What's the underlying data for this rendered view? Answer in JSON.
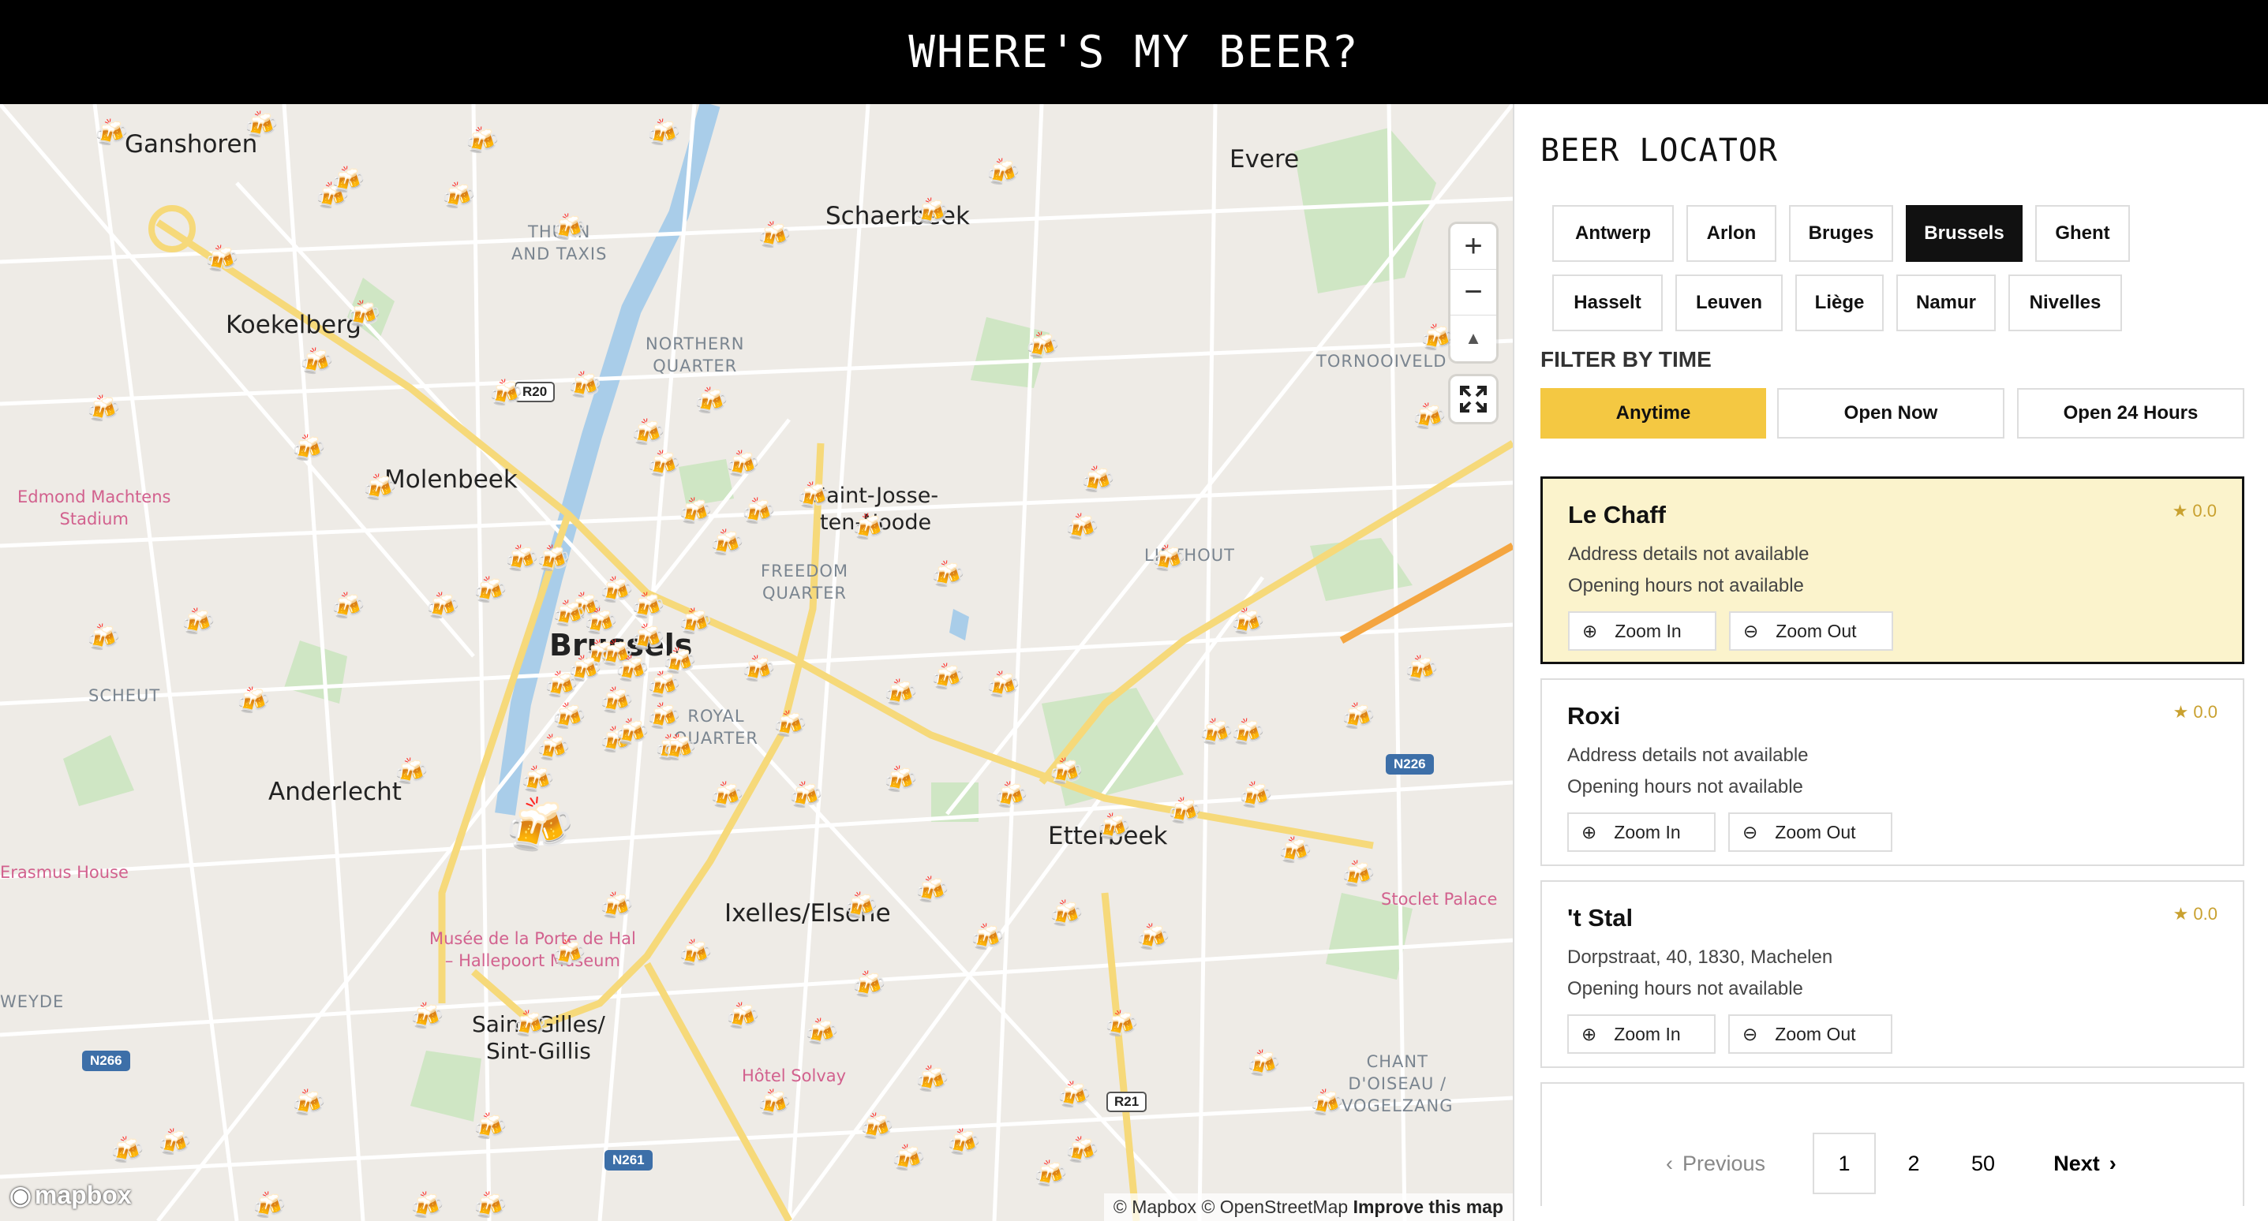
{
  "header": {
    "title": "WHERE'S MY BEER?"
  },
  "map": {
    "labels": {
      "ganshoren": "Ganshoren",
      "koekelberg": "Koekelberg",
      "molenbeek": "Molenbeek",
      "anderlecht": "Anderlecht",
      "schaerbeek": "Schaerbeek",
      "evere": "Evere",
      "saint_josse": "Saint-Josse-\nten-Noode",
      "brussels": "Brussels",
      "etterbeek": "Etterbeek",
      "ixelles": "Ixelles/Elsene",
      "saint_gilles": "Saint-Gilles/\nSint-Gillis",
      "thurn": "THURN\nAND TAXIS",
      "northern": "NORTHERN\nQUARTER",
      "freedom": "FREEDOM\nQUARTER",
      "royal": "ROYAL\nQUARTER",
      "tornooiveld": "TORNOOIVELD",
      "linthout": "LINTHOUT",
      "scheut": "SCHEUT",
      "weyde": "WEYDE",
      "chant": "CHANT\nD'OISEAU /\nVOGELZANG",
      "edmond": "Edmond Machtens\nStadium",
      "erasmus": "Erasmus House",
      "musee": "Musée de la Porte de Hal\n– Hallepoort Museum",
      "solvay": "Hôtel Solvay",
      "stoclet": "Stoclet Palace"
    },
    "shields": {
      "r20": "R20",
      "n226": "N226",
      "n266": "N266",
      "r21": "R21",
      "n261": "N261"
    },
    "controls": {
      "zoom_in": "+",
      "zoom_out": "−",
      "compass": "▲"
    },
    "attribution": {
      "mapbox": "© Mapbox",
      "osm": "© OpenStreetMap",
      "improve": "Improve this map"
    },
    "logo": "mapbox",
    "marker_icon": "beer-mug-icon"
  },
  "sidebar": {
    "title": "BEER LOCATOR",
    "cities": [
      {
        "label": "Antwerp",
        "active": false
      },
      {
        "label": "Arlon",
        "active": false
      },
      {
        "label": "Bruges",
        "active": false
      },
      {
        "label": "Brussels",
        "active": true
      },
      {
        "label": "Ghent",
        "active": false
      },
      {
        "label": "Hasselt",
        "active": false
      },
      {
        "label": "Leuven",
        "active": false
      },
      {
        "label": "Liège",
        "active": false
      },
      {
        "label": "Namur",
        "active": false
      },
      {
        "label": "Nivelles",
        "active": false
      }
    ],
    "filter_title": "FILTER BY TIME",
    "time_filters": [
      {
        "label": "Anytime",
        "active": true
      },
      {
        "label": "Open Now",
        "active": false
      },
      {
        "label": "Open 24 Hours",
        "active": false
      }
    ],
    "bars": [
      {
        "name": "Le Chaff",
        "rating": "0.0",
        "address": "Address details not available",
        "hours": "Opening hours not available",
        "zoom_in": "Zoom In",
        "zoom_out": "Zoom Out"
      },
      {
        "name": "Roxi",
        "rating": "0.0",
        "address": "Address details not available",
        "hours": "Opening hours not available",
        "zoom_in": "Zoom In",
        "zoom_out": "Zoom Out"
      },
      {
        "name": "'t Stal",
        "rating": "0.0",
        "address": "Dorpstraat, 40, 1830, Machelen",
        "hours": "Opening hours not available",
        "zoom_in": "Zoom In",
        "zoom_out": "Zoom Out"
      }
    ],
    "pagination": {
      "previous": "Previous",
      "pages": [
        "1",
        "2",
        "50"
      ],
      "next": "Next"
    },
    "accent_color": "#f4c842"
  }
}
